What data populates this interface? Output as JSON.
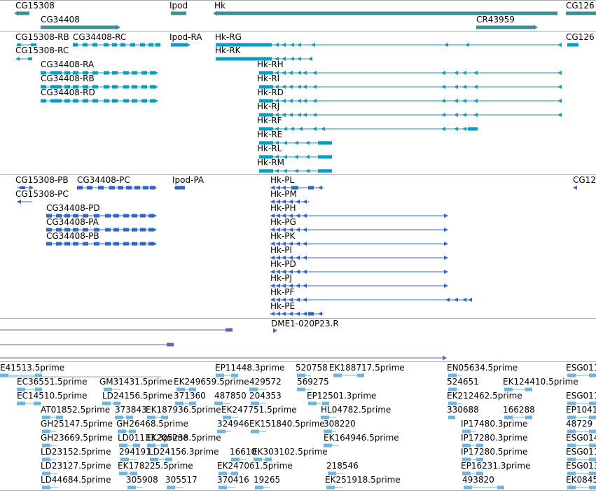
{
  "colors": {
    "gene": "#3d8f94",
    "transcript": "#0c9cbf",
    "protein": "#3366cc",
    "probe": "#7e55b3",
    "est": "#72b4e0",
    "divider": "#aaaaaa"
  },
  "tracks": {
    "genes": {
      "labels": [
        "CG15308",
        "Ipod",
        "Hk",
        "CG126",
        "CG34408",
        "CR43959"
      ]
    },
    "transcripts": {
      "labels": [
        "CG15308-RB",
        "CG34408-RC",
        "Ipod-RA",
        "Hk-RG",
        "CG126",
        "CG15308-RC",
        "Hk-RK",
        "CG34408-RA",
        "Hk-RH",
        "CG34408-RB",
        "Hk-RI",
        "CG34408-RD",
        "Hk-RD",
        "Hk-RJ",
        "Hk-RF",
        "Hk-RE",
        "Hk-RL",
        "Hk-RM"
      ]
    },
    "proteins": {
      "labels": [
        "CG15308-PB",
        "CG34408-PC",
        "Ipod-PA",
        "Hk-PL",
        "CG12",
        "CG15308-PC",
        "Hk-PM",
        "CG34408-PD",
        "Hk-PH",
        "CG34408-PA",
        "Hk-PG",
        "CG34408-PB",
        "Hk-PK",
        "Hk-PI",
        "Hk-PD",
        "Hk-PJ",
        "Hk-PF",
        "Hk-PE"
      ]
    },
    "probes": {
      "labels": [
        "DME1-020P23.R"
      ]
    },
    "ests": {
      "labels": [
        "E41513.5prime",
        "EP11448.3prime",
        "520758",
        "EK188717.5prime",
        "EN05634.5prime",
        "ESG011",
        "EC36551.5prime",
        "GM31431.5prime",
        "EK249659.5prime",
        "429572",
        "569275",
        "524651",
        "EK124410.5prime",
        "EC14510.5prime",
        "LD24156.5prime",
        "371360",
        "487850",
        "204353",
        "EP12501.3prime",
        "EK212462.5prime",
        "ESG011",
        "AT01852.5prime",
        "373843",
        "EK187936.5prime",
        "EK247751.5prime",
        "HL04782.5prime",
        "330688",
        "166288",
        "EP1041",
        "GH25147.5prime",
        "GH26468.5prime",
        "324946",
        "EK151840.5prime",
        "308220",
        "IP17480.3prime",
        "48729",
        "GH23669.5prime",
        "LD01133.3prime",
        "EK205238.5prime",
        "EK164946.5prime",
        "IP17280.3prime",
        "ESG014",
        "LD23152.5prime",
        "294191",
        "LD24156.3prime",
        "16610",
        "EK303102.5prime",
        "IP17280.5prime",
        "ESG011",
        "LD23127.5prime",
        "EK178225.5prime",
        "EK247061.5prime",
        "218546",
        "EP16231.3prime",
        "ESG013",
        "LD44684.5prime",
        "305908",
        "305517",
        "370416",
        "19265",
        "EK251918.5prime",
        "493820",
        "EK0845"
      ]
    }
  }
}
